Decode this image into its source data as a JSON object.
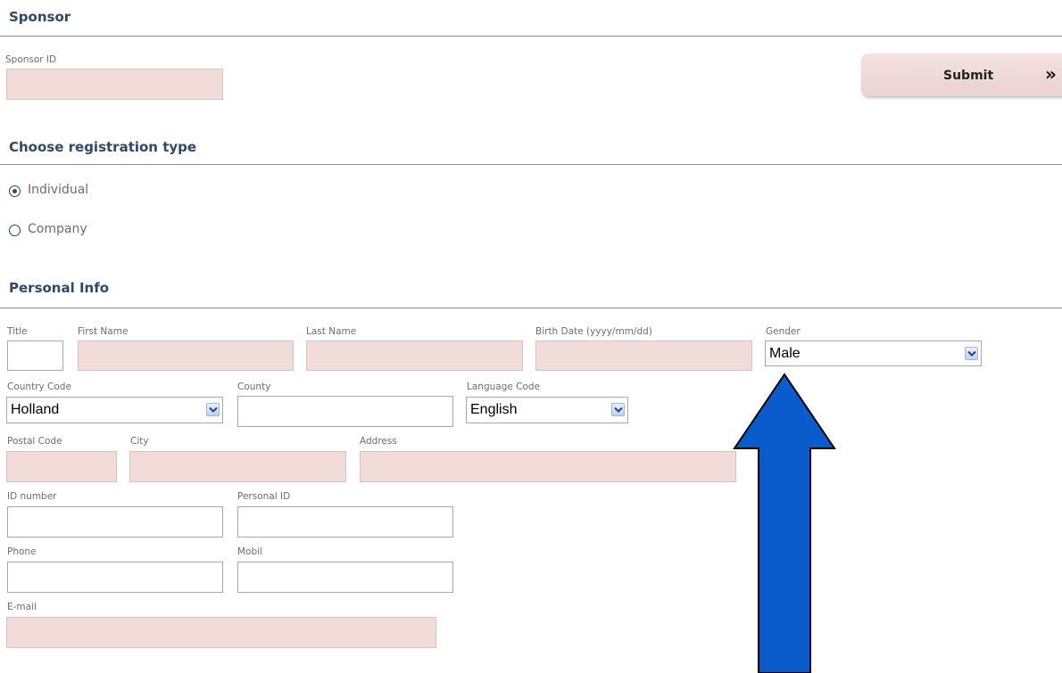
{
  "sections": {
    "sponsor": "Sponsor",
    "registration": "Choose registration type",
    "personal": "Personal Info"
  },
  "sponsor": {
    "id_label": "Sponsor ID",
    "id_value": "",
    "submit_label": "Submit",
    "submit_icon": "»"
  },
  "registration": {
    "options": [
      {
        "label": "Individual",
        "selected": true
      },
      {
        "label": "Company",
        "selected": false
      }
    ]
  },
  "personal": {
    "labels": {
      "title": "Title",
      "first_name": "First Name",
      "last_name": "Last Name",
      "birth_date": "Birth Date (yyyy/mm/dd)",
      "gender": "Gender",
      "country_code": "Country Code",
      "county": "County",
      "language_code": "Language Code",
      "postal_code": "Postal Code",
      "city": "City",
      "address": "Address",
      "id_number": "ID number",
      "personal_id": "Personal ID",
      "phone": "Phone",
      "mobil": "Mobil",
      "email": "E-mail"
    },
    "values": {
      "gender": "Male",
      "country_code": "Holland",
      "language_code": "English"
    }
  },
  "annotation": {
    "arrow_color": "#0a5ccc",
    "arrow_outline": "#000000",
    "points_to": "gender-select"
  },
  "colors": {
    "heading": "#2e4a66",
    "required_field_bg": "#f2dcda",
    "label": "#6d6d6d"
  }
}
